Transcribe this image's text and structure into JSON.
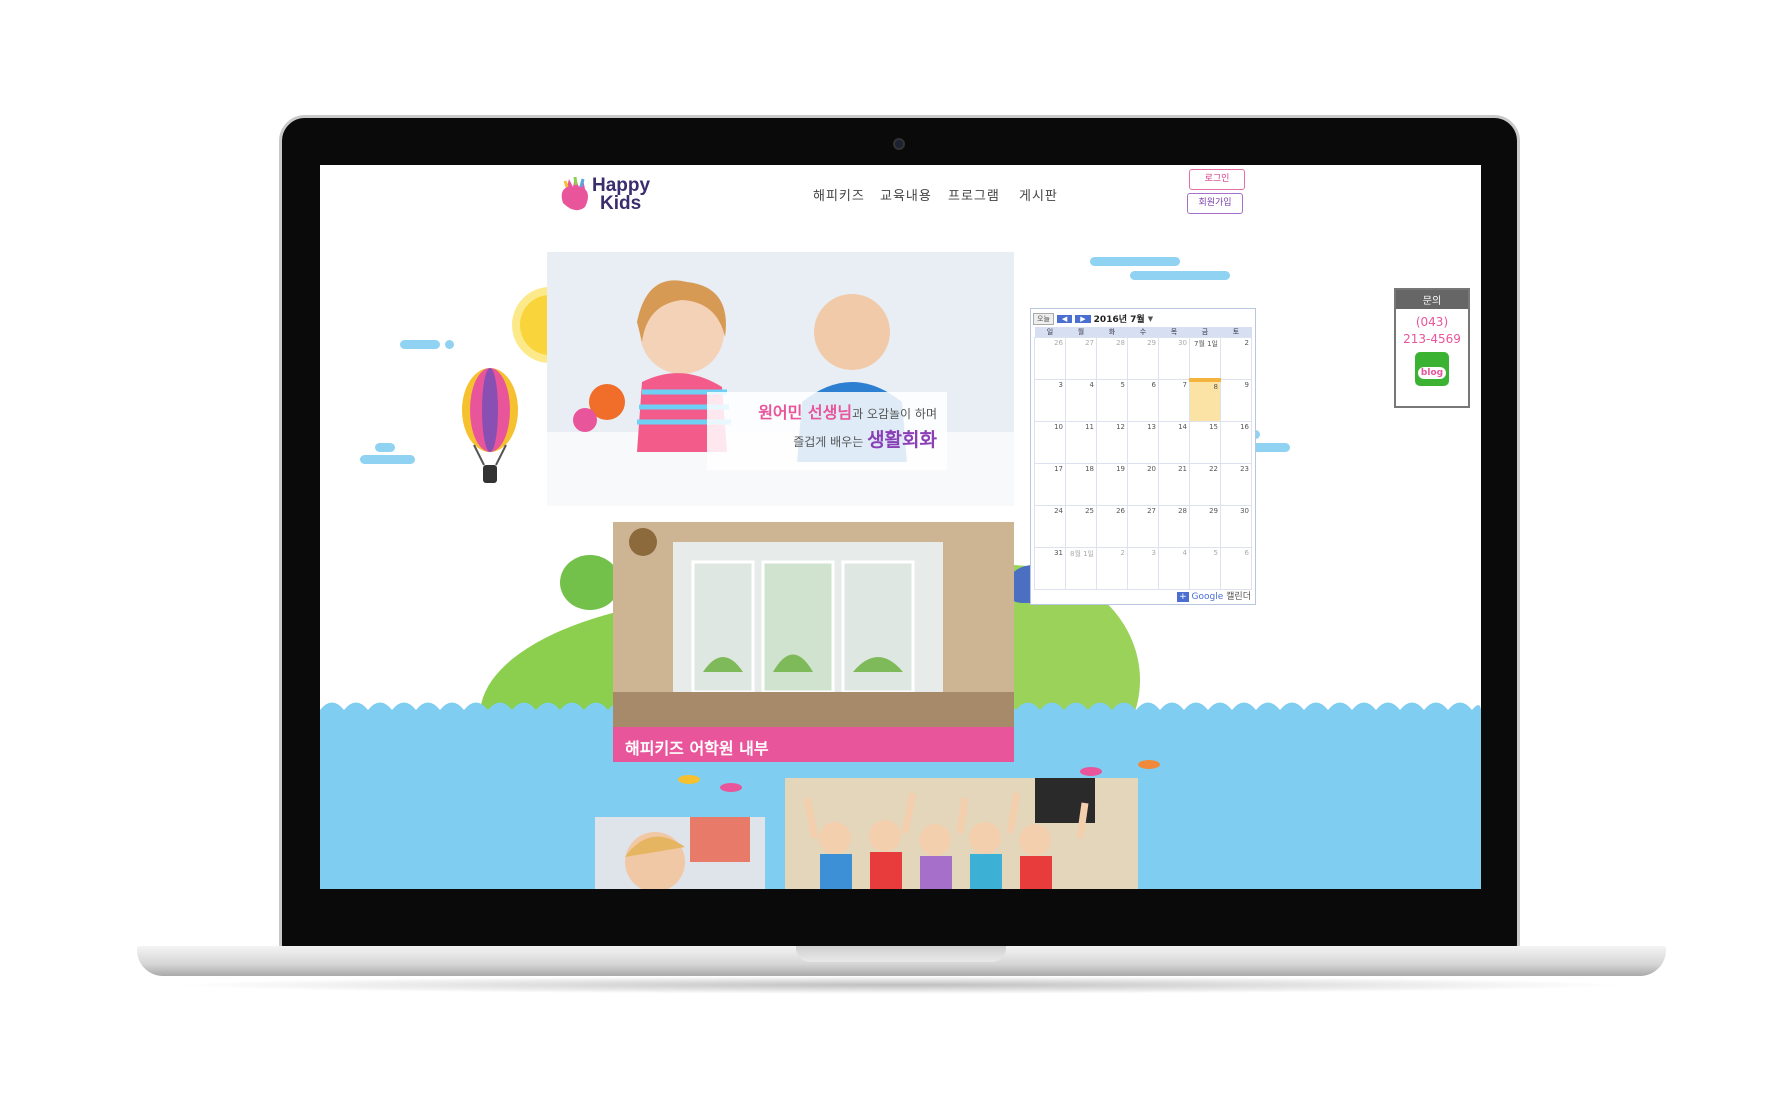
{
  "site": {
    "brand_line1": "Happy",
    "brand_line2": "Kids",
    "nav": [
      "해피키즈",
      "교육내용",
      "프로그램",
      "게시판"
    ],
    "login_label": "로그인",
    "signup_label": "회원가입"
  },
  "hero": {
    "line1_part1": "원어민 선생님",
    "line1_part2": "과 오감놀이 하며",
    "line2_part1": "즐겁게 배우는",
    "line2_part2": "생활회화"
  },
  "room": {
    "caption": "해피키즈 어학원 내부"
  },
  "calendar": {
    "today_label": "오늘",
    "prev": "◀",
    "next": "▶",
    "month_label": "2016년 7월",
    "weekdays": [
      "일",
      "월",
      "화",
      "수",
      "목",
      "금",
      "토"
    ],
    "weeks": [
      [
        "26",
        "27",
        "28",
        "29",
        "30",
        "7월 1일",
        "2"
      ],
      [
        "3",
        "4",
        "5",
        "6",
        "7",
        "8",
        "9"
      ],
      [
        "10",
        "11",
        "12",
        "13",
        "14",
        "15",
        "16"
      ],
      [
        "17",
        "18",
        "19",
        "20",
        "21",
        "22",
        "23"
      ],
      [
        "24",
        "25",
        "26",
        "27",
        "28",
        "29",
        "30"
      ],
      [
        "31",
        "8월 1일",
        "2",
        "3",
        "4",
        "5",
        "6"
      ]
    ],
    "google_label": "Google",
    "calendar_label": "캘린더",
    "highlight_color": "#fbe3a6"
  },
  "inquiry": {
    "title": "문의",
    "phone_line1": "(043)",
    "phone_line2": "213-4569",
    "blog_label": "blog"
  },
  "colors": {
    "accent_pink": "#e8559b",
    "sky_blue": "#7fcdf0",
    "grass_green": "#8ccf4f",
    "brand_purple": "#3a2c6d"
  }
}
